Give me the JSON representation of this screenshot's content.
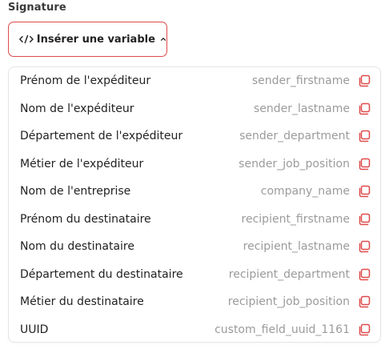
{
  "section": {
    "label": "Signature"
  },
  "insert_button": {
    "label": "Insérer une variable",
    "icon": "code-icon",
    "chevron": "chevron-up-icon"
  },
  "accent_color": "#e04a4a",
  "variables": [
    {
      "label": "Prénom de l'expéditeur",
      "value": "sender_firstname"
    },
    {
      "label": "Nom de l'expéditeur",
      "value": "sender_lastname"
    },
    {
      "label": "Département de l'expéditeur",
      "value": "sender_department"
    },
    {
      "label": "Métier de l'expéditeur",
      "value": "sender_job_position"
    },
    {
      "label": "Nom de l'entreprise",
      "value": "company_name"
    },
    {
      "label": "Prénom du destinataire",
      "value": "recipient_firstname"
    },
    {
      "label": "Nom du destinataire",
      "value": "recipient_lastname"
    },
    {
      "label": "Département du destinataire",
      "value": "recipient_department"
    },
    {
      "label": "Métier du destinataire",
      "value": "recipient_job_position"
    },
    {
      "label": "UUID",
      "value": "custom_field_uuid_1161"
    }
  ]
}
